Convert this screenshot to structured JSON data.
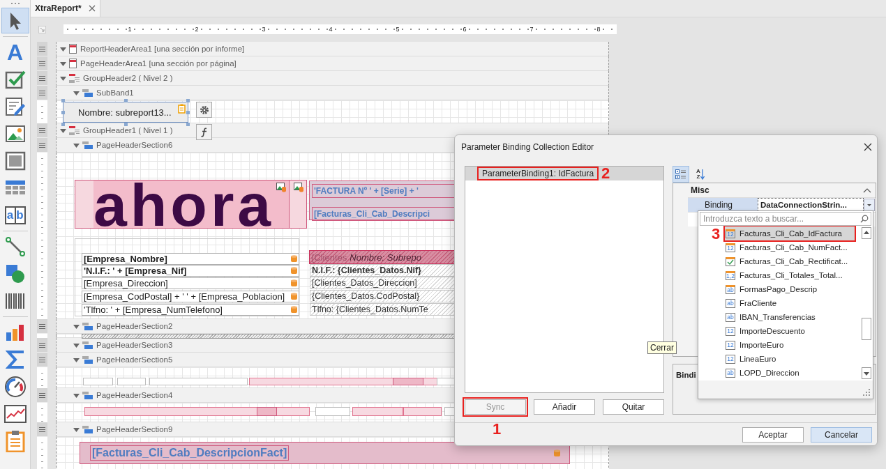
{
  "toolbox": {
    "items": [
      {
        "kind": "pointer",
        "selected": true,
        "separator_before": false
      },
      {
        "kind": "label",
        "glyph": "A",
        "selected": false,
        "separator_before": true
      },
      {
        "kind": "checkbox",
        "selected": false,
        "separator_before": false
      },
      {
        "kind": "rich_text",
        "selected": false,
        "separator_before": false
      },
      {
        "kind": "picture",
        "selected": false,
        "separator_before": false
      },
      {
        "kind": "panel",
        "selected": false,
        "separator_before": false
      },
      {
        "kind": "table",
        "selected": false,
        "separator_before": false
      },
      {
        "kind": "character_comb",
        "glyphs": [
          "a",
          "b"
        ],
        "selected": false,
        "separator_before": false
      },
      {
        "kind": "line",
        "selected": false,
        "separator_before": true
      },
      {
        "kind": "shape",
        "selected": false,
        "separator_before": false
      },
      {
        "kind": "barcode",
        "selected": false,
        "separator_before": false
      },
      {
        "kind": "chart",
        "selected": false,
        "separator_before": true
      },
      {
        "kind": "summary",
        "selected": false,
        "separator_before": false
      },
      {
        "kind": "gauge",
        "selected": false,
        "separator_before": false
      },
      {
        "kind": "sparkline",
        "selected": false,
        "separator_before": false
      },
      {
        "kind": "subreport",
        "selected": false,
        "separator_before": false
      }
    ]
  },
  "tabs": [
    {
      "title": "XtraReport*",
      "selected": true
    }
  ],
  "ruler": {
    "marks": [
      "1",
      "2",
      "3",
      "4",
      "5",
      "6",
      "7",
      "8"
    ]
  },
  "report": {
    "bands": [
      {
        "label": "ReportHeaderArea1 [una sección por informe]",
        "kind": "area",
        "expanded": true
      },
      {
        "label": "PageHeaderArea1 [una sección por página]",
        "kind": "area",
        "expanded": true
      },
      {
        "label": "GroupHeader2 ( Nivel 2 )",
        "kind": "group",
        "expanded": true,
        "children": [
          {
            "label": "SubBand1",
            "kind": "section",
            "expanded": true,
            "controls": [
              {
                "kind": "subreport",
                "text": "Nombre: subreport13...",
                "selected": true
              }
            ]
          }
        ]
      },
      {
        "label": "GroupHeader1 ( Nivel 1 )",
        "kind": "group",
        "expanded": true,
        "children": [
          {
            "label": "PageHeaderSection6",
            "kind": "section",
            "expanded": true,
            "controls": [
              {
                "kind": "logo",
                "text": "ahora"
              },
              {
                "kind": "title_box",
                "lines": [
                  "'FACTURA Nº ' + [Serie] + '",
                  "[Facturas_Cli_Cab_Descripci"
                ]
              },
              {
                "kind": "company_panel",
                "fields": [
                  {
                    "text": "[Empresa_Nombre]",
                    "bold": true
                  },
                  {
                    "text": "'N.I.F.: ' + [Empresa_Nif]",
                    "bold": true
                  },
                  {
                    "text": "[Empresa_Direccion]",
                    "bold": false
                  },
                  {
                    "text": "[Empresa_CodPostal] + ' ' + [Empresa_Poblacion]",
                    "bold": false
                  },
                  {
                    "text": "'Tlfno: ' + [Empresa_NumTelefono]",
                    "bold": false
                  }
                ]
              },
              {
                "kind": "client_panel",
                "header": [
                  "{Clientes",
                  "Nombre: Subrepo"
                ],
                "fields": [
                  {
                    "text": "N.I.F.: {Clientes_Datos.Nif}",
                    "bold": true
                  },
                  {
                    "text": "[Clientes_Datos_Direccion]",
                    "bold": false
                  },
                  {
                    "text": "{Clientes_Datos.CodPostal}",
                    "bold": false
                  },
                  {
                    "text": "Tlfno: {Clientes_Datos.NumTe",
                    "bold": false
                  }
                ]
              }
            ]
          },
          {
            "label": "PageHeaderSection2",
            "kind": "section",
            "expanded": true,
            "controls": [
              {
                "kind": "strip"
              }
            ]
          },
          {
            "label": "PageHeaderSection3",
            "kind": "section",
            "expanded": true
          },
          {
            "label": "PageHeaderSection5",
            "kind": "section",
            "expanded": true,
            "controls": [
              {
                "kind": "cell_row",
                "cells": [
                  {
                    "bound": false
                  },
                  {
                    "bound": false
                  },
                  {
                    "bound": false
                  },
                  {
                    "bound": true
                  },
                  {
                    "bound": false
                  }
                ]
              }
            ]
          },
          {
            "label": "PageHeaderSection4",
            "kind": "section",
            "expanded": true,
            "controls": [
              {
                "kind": "cell_row",
                "cells": [
                  {
                    "bound": true
                  },
                  {
                    "bound": false
                  },
                  {
                    "bound": true
                  },
                  {
                    "bound": true
                  },
                  {
                    "bound": false
                  }
                ]
              }
            ]
          },
          {
            "label": "PageHeaderSection9",
            "kind": "section",
            "expanded": true,
            "controls": [
              {
                "kind": "title_field",
                "text": "[Facturas_Cli_Cab_DescripcionFact]"
              }
            ]
          }
        ]
      }
    ]
  },
  "dialog": {
    "title": "Parameter Binding Collection Editor",
    "items": [
      {
        "label": "ParameterBinding1: IdFactura",
        "selected": true,
        "callout": "2"
      }
    ],
    "buttons": [
      {
        "label": "Sync",
        "disabled": true,
        "callout": "1"
      },
      {
        "label": "Añadir",
        "disabled": false
      },
      {
        "label": "Quitar",
        "disabled": false
      }
    ],
    "property_grid": {
      "toolbar": [
        {
          "kind": "categorized",
          "selected": true
        },
        {
          "kind": "alphabetical",
          "glyphs": [
            "A",
            "Z"
          ],
          "selected": false
        }
      ],
      "category": {
        "label": "Misc",
        "expanded": true
      },
      "rows": [
        {
          "label": "Binding",
          "value": "DataConnectionStrin...",
          "selected": true
        }
      ],
      "description": "Bindi"
    },
    "dropdown": {
      "placeholder": "Introduzca texto a buscar...",
      "items": [
        {
          "label": "Facturas_Cli_Cab_IdFactura",
          "kind": "number",
          "glyph": "12",
          "flagged": true,
          "selected": true,
          "callout": "3"
        },
        {
          "label": "Facturas_Cli_Cab_NumFact...",
          "kind": "number",
          "glyph": "12",
          "flagged": true,
          "selected": false
        },
        {
          "label": "Facturas_Cli_Cab_Rectificat...",
          "kind": "boolean",
          "flagged": true,
          "selected": false
        },
        {
          "label": "Facturas_Cli_Totales_Total...",
          "kind": "number",
          "glyph": "1,2",
          "flagged": true,
          "selected": false
        },
        {
          "label": "FormasPago_Descrip",
          "kind": "text",
          "glyph": "ab",
          "flagged": true,
          "selected": false
        },
        {
          "label": "FraCliente",
          "kind": "text",
          "glyph": "ab",
          "flagged": false,
          "selected": false
        },
        {
          "label": "IBAN_Transferencias",
          "kind": "text",
          "glyph": "ab",
          "flagged": false,
          "selected": false
        },
        {
          "label": "ImporteDescuento",
          "kind": "number",
          "glyph": "12",
          "flagged": false,
          "selected": false
        },
        {
          "label": "ImporteEuro",
          "kind": "number",
          "glyph": "12",
          "flagged": false,
          "selected": false
        },
        {
          "label": "LineaEuro",
          "kind": "number",
          "glyph": "12",
          "flagged": false,
          "selected": false
        },
        {
          "label": "LOPD_Direccion",
          "kind": "text",
          "glyph": "ab",
          "flagged": false,
          "selected": false
        }
      ]
    },
    "footer_buttons": [
      {
        "label": "Aceptar",
        "default": false
      },
      {
        "label": "Cancelar",
        "default": true
      }
    ]
  },
  "tooltip": {
    "text": "Cerrar"
  }
}
